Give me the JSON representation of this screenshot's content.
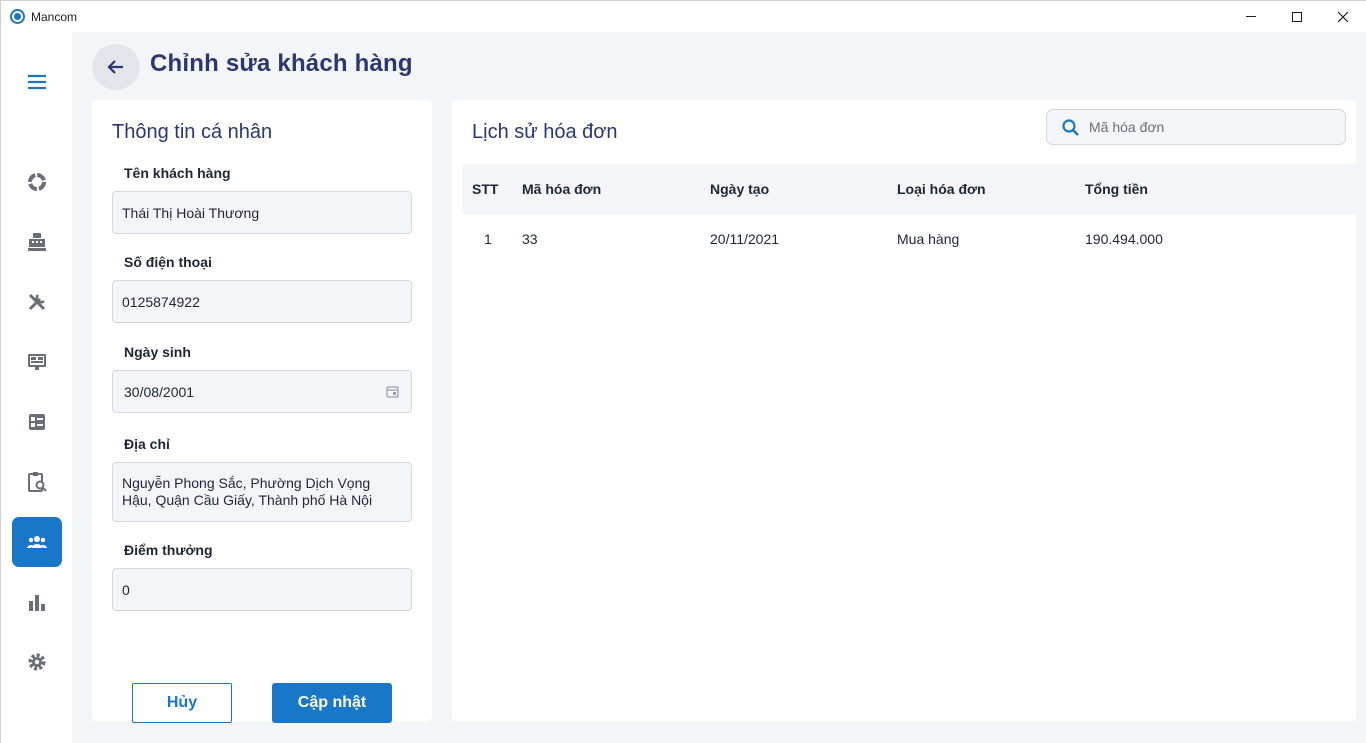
{
  "window": {
    "title": "Mancom"
  },
  "page": {
    "title": "Chỉnh sửa khách hàng"
  },
  "sidebar": {
    "items": [
      {
        "name": "menu-icon"
      },
      {
        "name": "overview-icon"
      },
      {
        "name": "cash-register-icon"
      },
      {
        "name": "tools-icon"
      },
      {
        "name": "monitor-icon"
      },
      {
        "name": "dashboard-list-icon"
      },
      {
        "name": "clipboard-search-icon"
      },
      {
        "name": "customers-icon",
        "active": true
      },
      {
        "name": "bar-chart-icon"
      },
      {
        "name": "settings-icon"
      }
    ],
    "accent": "#1877c9"
  },
  "personal": {
    "title": "Thông tin cá nhân",
    "name_label": "Tên khách hàng",
    "name_value": "Thái Thị Hoài Thương",
    "phone_label": "Số điện thoại",
    "phone_value": "0125874922",
    "dob_label": "Ngày sinh",
    "dob_value": "30/08/2001",
    "address_label": "Địa chỉ",
    "address_value": "Nguyễn Phong Sắc, Phường Dịch Vọng Hậu, Quận Cầu Giấy, Thành phố Hà Nội",
    "points_label": "Điểm thưởng",
    "points_value": "0",
    "cancel_label": "Hủy",
    "update_label": "Cập nhật"
  },
  "history": {
    "title": "Lịch sử hóa đơn",
    "search_placeholder": "Mã hóa đơn",
    "columns": [
      "STT",
      "Mã hóa đơn",
      "Ngày tạo",
      "Loại hóa đơn",
      "Tổng tiền"
    ],
    "rows": [
      [
        "1",
        "33",
        "20/11/2021",
        "Mua hàng",
        "190.494.000"
      ]
    ]
  },
  "colors": {
    "title": "#2b3674",
    "primary": "#1877c9",
    "background": "#f4f5f9"
  }
}
